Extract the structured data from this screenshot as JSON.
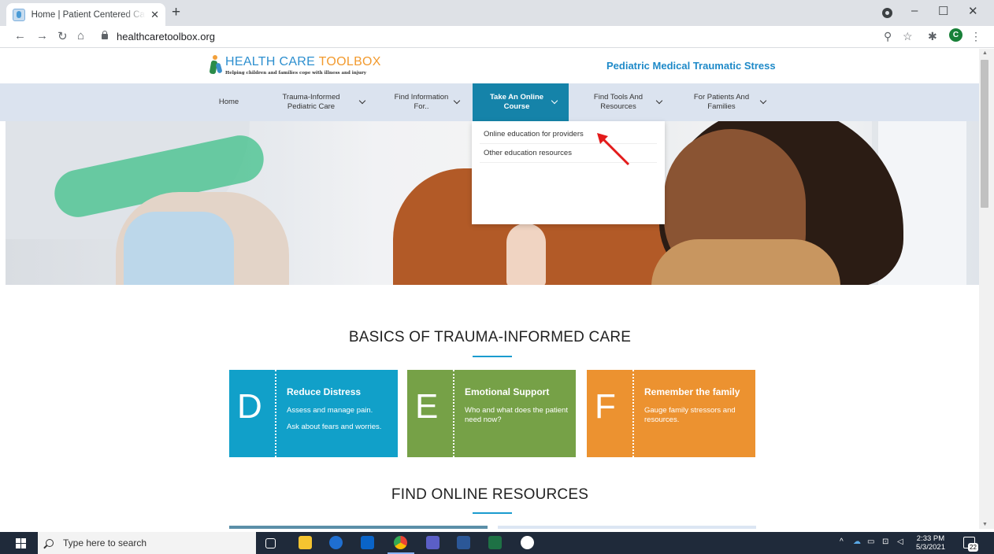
{
  "browser": {
    "tab_title": "Home | Patient Centered Care and",
    "url": "healthcaretoolbox.org",
    "avatar_letter": "C"
  },
  "site": {
    "logo_part1": "HEALTH ",
    "logo_part2": "CARE ",
    "logo_part3": "TOOLBOX",
    "logo_tagline": "Helping children and families cope with illness and injury",
    "subtitle": "Pediatric Medical Traumatic Stress"
  },
  "nav": {
    "items": [
      {
        "label": "Home"
      },
      {
        "label": "Trauma-Informed\nPediatric Care"
      },
      {
        "label": "Find Information\nFor.."
      },
      {
        "label": "Take An Online\nCourse"
      },
      {
        "label": "Find Tools And\nResources"
      },
      {
        "label": "For Patients And\nFamilies"
      }
    ],
    "active_index": 3
  },
  "dropdown": {
    "items": [
      {
        "label": "Online education for providers"
      },
      {
        "label": "Other education resources"
      }
    ]
  },
  "basics": {
    "title": "BASICS OF TRAUMA-INFORMED CARE",
    "cards": [
      {
        "letter": "D",
        "title": "Reduce Distress",
        "text": "Assess and manage pain.",
        "text2": "Ask about fears and worries.",
        "color": "#11a0c9"
      },
      {
        "letter": "E",
        "title": "Emotional Support",
        "text": "Who and what does the patient need now?",
        "text2": "",
        "color": "#76a147"
      },
      {
        "letter": "F",
        "title": "Remember the family",
        "text": "Gauge family stressors and resources.",
        "text2": "",
        "color": "#ec9230"
      }
    ]
  },
  "resources": {
    "title": "FIND ONLINE RESOURCES"
  },
  "taskbar": {
    "search_placeholder": "Type here to search",
    "time": "2:33 PM",
    "date": "5/3/2021",
    "notif_count": "22"
  },
  "colors": {
    "nav_bg": "#dbe3ef",
    "nav_active": "#1583a9",
    "accent_blue": "#1f8ac8",
    "annotation_red": "#e31b1b"
  }
}
